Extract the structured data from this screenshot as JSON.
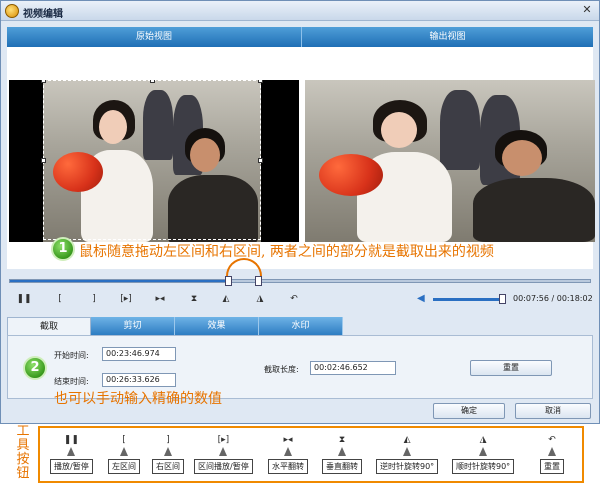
{
  "window": {
    "title": "视频编辑",
    "close_glyph": "✕"
  },
  "views": {
    "original": "原始视图",
    "output": "输出视图"
  },
  "annotations": {
    "one_number": "1",
    "one_text": "鼠标随意拖动左区间和右区间, 两者之间的部分就是截取出来的视频",
    "two_number": "2",
    "two_text": "也可以手动输入精确的数值"
  },
  "playback": {
    "current_time": "00:07:56",
    "total_time": "00:18:02",
    "time_separator": "/",
    "progress_fraction": 0.38
  },
  "tabs": [
    "截取",
    "剪切",
    "效果",
    "水印"
  ],
  "trim": {
    "start_label": "开始时间:",
    "start_value": "00:23:46.974",
    "end_label": "结束时间:",
    "end_value": "00:26:33.626",
    "length_label": "截取长度:",
    "length_value": "00:02:46.652",
    "reset_label": "重置"
  },
  "dialog": {
    "ok_label": "确定",
    "cancel_label": "取消"
  },
  "legend": {
    "side_title": "工具按钮",
    "items": [
      {
        "icon": "pause-icon",
        "glyph": "❚❚",
        "label": "播放/暂停"
      },
      {
        "icon": "left-bracket-icon",
        "glyph": "[",
        "label": "左区间"
      },
      {
        "icon": "right-bracket-icon",
        "glyph": "]",
        "label": "右区间"
      },
      {
        "icon": "range-play-icon",
        "glyph": "[▸]",
        "label": "区间播放/暂停"
      },
      {
        "icon": "flip-horizontal-icon",
        "glyph": "▸◂",
        "label": "水平翻转"
      },
      {
        "icon": "flip-vertical-icon",
        "glyph": "⧗",
        "label": "垂直翻转"
      },
      {
        "icon": "rotate-ccw-icon",
        "glyph": "◭",
        "label": "逆时针旋转90°"
      },
      {
        "icon": "rotate-cw-icon",
        "glyph": "◮",
        "label": "顺时针旋转90°"
      },
      {
        "icon": "reset-icon",
        "glyph": "↶",
        "label": "重置"
      }
    ]
  },
  "colors": {
    "accent": "#2a6fc2",
    "annotation": "#e77400",
    "header": "#1f6fb5"
  }
}
